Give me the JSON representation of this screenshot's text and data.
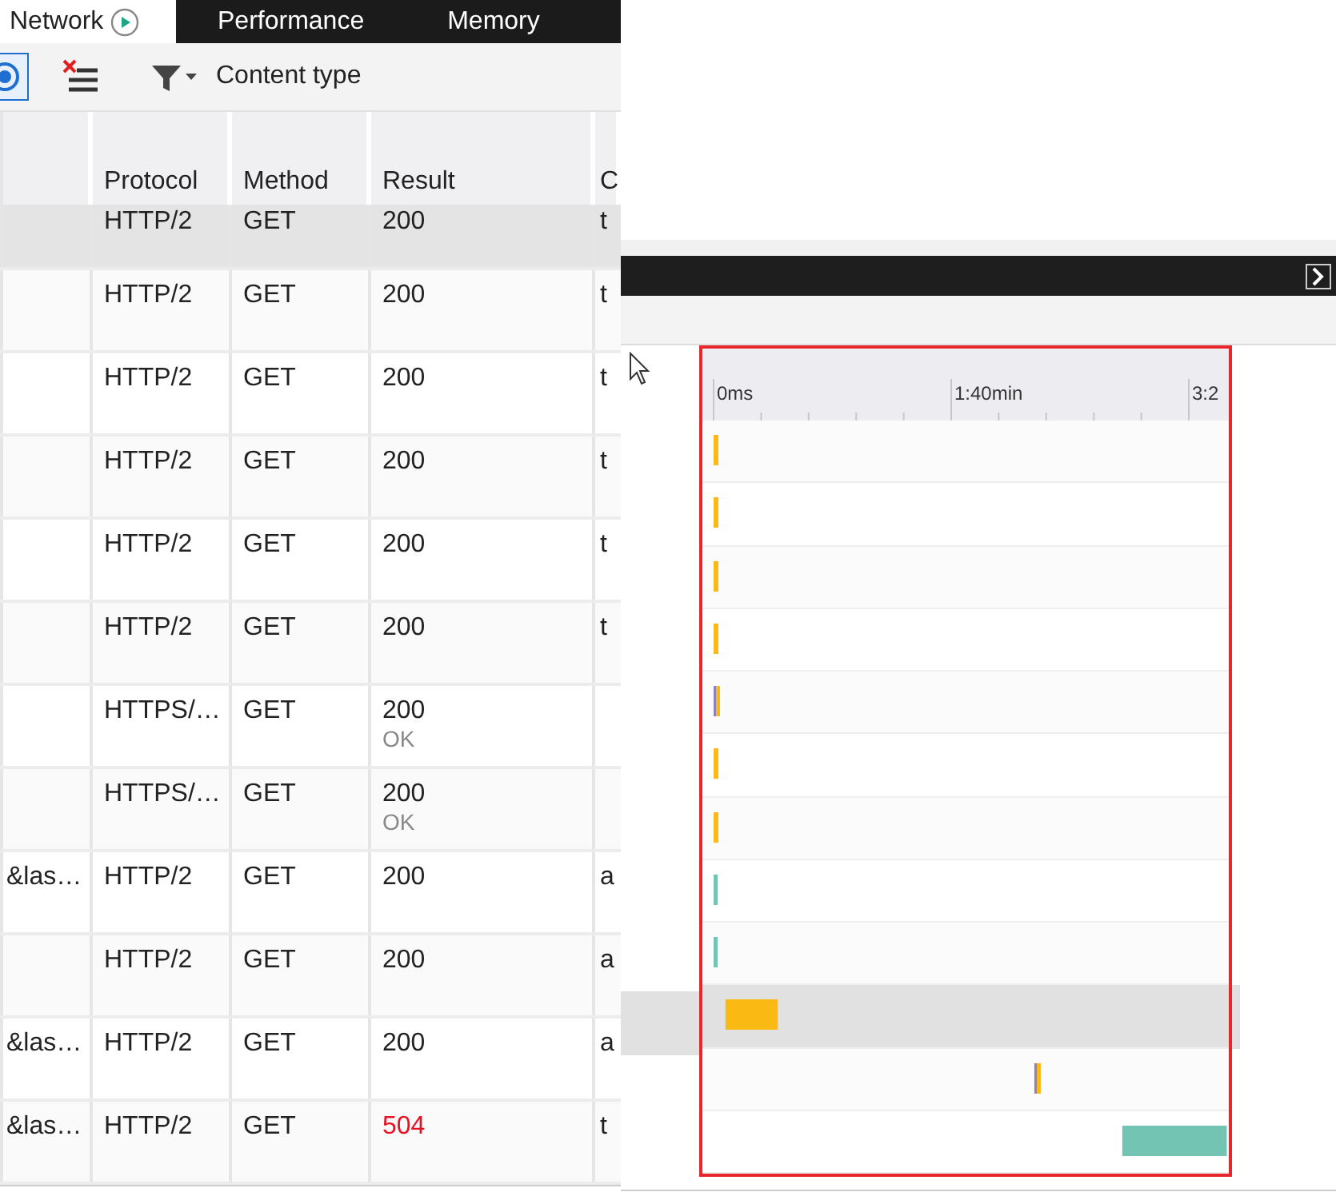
{
  "tabs": [
    {
      "label": "Network",
      "selected": true
    },
    {
      "label": "Performance",
      "selected": false
    },
    {
      "label": "Memory",
      "selected": false
    }
  ],
  "toolbar": {
    "filter_label": "Content type"
  },
  "table": {
    "columns": [
      "Protocol",
      "Method",
      "Result",
      "C"
    ],
    "rows": [
      {
        "name": "",
        "protocol": "HTTP/2",
        "method": "GET",
        "result": "200",
        "result_text": "",
        "column_5": "t",
        "error": false,
        "selected": true
      },
      {
        "name": "",
        "protocol": "HTTP/2",
        "method": "GET",
        "result": "200",
        "result_text": "",
        "column_5": "t",
        "error": false,
        "selected": false
      },
      {
        "name": "",
        "protocol": "HTTP/2",
        "method": "GET",
        "result": "200",
        "result_text": "",
        "column_5": "t",
        "error": false,
        "selected": false
      },
      {
        "name": "",
        "protocol": "HTTP/2",
        "method": "GET",
        "result": "200",
        "result_text": "",
        "column_5": "t",
        "error": false,
        "selected": false
      },
      {
        "name": "",
        "protocol": "HTTP/2",
        "method": "GET",
        "result": "200",
        "result_text": "",
        "column_5": "t",
        "error": false,
        "selected": false
      },
      {
        "name": "",
        "protocol": "HTTP/2",
        "method": "GET",
        "result": "200",
        "result_text": "",
        "column_5": "t",
        "error": false,
        "selected": false
      },
      {
        "name": "",
        "protocol": "HTTPS/…",
        "method": "GET",
        "result": "200",
        "result_text": "OK",
        "column_5": "",
        "error": false,
        "selected": false
      },
      {
        "name": "",
        "protocol": "HTTPS/…",
        "method": "GET",
        "result": "200",
        "result_text": "OK",
        "column_5": "",
        "error": false,
        "selected": false
      },
      {
        "name": "&las…",
        "protocol": "HTTP/2",
        "method": "GET",
        "result": "200",
        "result_text": "",
        "column_5": "a",
        "error": false,
        "selected": false
      },
      {
        "name": "",
        "protocol": "HTTP/2",
        "method": "GET",
        "result": "200",
        "result_text": "",
        "column_5": "a",
        "error": false,
        "selected": false
      },
      {
        "name": "&las…",
        "protocol": "HTTP/2",
        "method": "GET",
        "result": "200",
        "result_text": "",
        "column_5": "a",
        "error": false,
        "selected": false
      },
      {
        "name": "&las…",
        "protocol": "HTTP/2",
        "method": "GET",
        "result": "504",
        "result_text": "",
        "column_5": "t",
        "error": true,
        "selected": false
      }
    ]
  },
  "timeline": {
    "rows": [
      {
        "selected": false
      },
      {
        "selected": false
      },
      {
        "selected": false
      },
      {
        "selected": false
      },
      {
        "selected": false
      },
      {
        "selected": false
      },
      {
        "selected": false
      },
      {
        "selected": false
      },
      {
        "selected": false
      },
      {
        "selected": true
      },
      {
        "selected": false
      },
      {
        "selected": false
      }
    ],
    "ticks": [
      "0ms",
      "1:40min",
      "3:2"
    ]
  }
}
